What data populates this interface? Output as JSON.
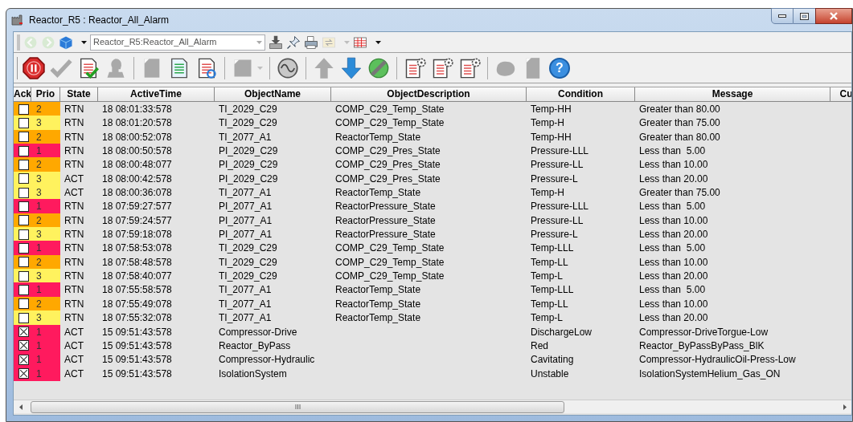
{
  "window": {
    "title": "Reactor_R5 : Reactor_All_Alarm"
  },
  "address_bar": {
    "value": "Reactor_R5:Reactor_All_Alarm",
    "tools": [
      {
        "kind": "back",
        "disabled": true
      },
      {
        "kind": "forward",
        "disabled": true
      },
      {
        "kind": "cube",
        "disabled": false
      },
      {
        "kind": "combo",
        "disabled": false
      },
      {
        "kind": "tray",
        "disabled": false
      },
      {
        "kind": "pin",
        "disabled": false
      },
      {
        "kind": "printer",
        "disabled": false
      },
      {
        "kind": "swap",
        "disabled": true
      },
      {
        "kind": "grid",
        "disabled": false
      }
    ]
  },
  "toolbar": [
    {
      "kind": "stop",
      "disabled": false
    },
    {
      "kind": "check",
      "disabled": true
    },
    {
      "kind": "checklist",
      "disabled": false
    },
    {
      "kind": "head",
      "disabled": true
    },
    {
      "kind": "separator"
    },
    {
      "kind": "page",
      "disabled": true
    },
    {
      "kind": "list",
      "disabled": false
    },
    {
      "kind": "page-refresh",
      "disabled": false
    },
    {
      "kind": "separator"
    },
    {
      "kind": "page-menu",
      "disabled": true
    },
    {
      "kind": "separator"
    },
    {
      "kind": "wave",
      "disabled": false
    },
    {
      "kind": "separator"
    },
    {
      "kind": "up",
      "disabled": true
    },
    {
      "kind": "down",
      "disabled": false
    },
    {
      "kind": "link",
      "disabled": false
    },
    {
      "kind": "separator"
    },
    {
      "kind": "page-gear",
      "disabled": false
    },
    {
      "kind": "page-gear",
      "disabled": false
    },
    {
      "kind": "page-gear",
      "disabled": false
    },
    {
      "kind": "separator"
    },
    {
      "kind": "blob",
      "disabled": true
    },
    {
      "kind": "door",
      "disabled": true
    },
    {
      "kind": "help",
      "disabled": false,
      "glyph": "?"
    }
  ],
  "table": {
    "columns": [
      "Ack",
      "Prio",
      "State",
      "ActiveTime",
      "ObjectName",
      "ObjectDescription",
      "Condition",
      "Message",
      "Cu"
    ],
    "rows": [
      {
        "acked": false,
        "color": "#ffa800",
        "prio": "2",
        "state": "RTN",
        "time": "18 08:01:33:578",
        "name": "TI_2029_C29",
        "description": "COMP_C29_Temp_State",
        "condition": "Temp-HH",
        "message": "Greater than 80.00"
      },
      {
        "acked": false,
        "color": "#fff25e",
        "prio": "3",
        "state": "RTN",
        "time": "18 08:01:20:578",
        "name": "TI_2029_C29",
        "description": "COMP_C29_Temp_State",
        "condition": "Temp-H",
        "message": "Greater than 75.00"
      },
      {
        "acked": false,
        "color": "#ffa800",
        "prio": "2",
        "state": "RTN",
        "time": "18 08:00:52:078",
        "name": "TI_2077_A1",
        "description": "ReactorTemp_State",
        "condition": "Temp-HH",
        "message": "Greater than 80.00"
      },
      {
        "acked": false,
        "color": "#ff1a5e",
        "prio": "1",
        "state": "RTN",
        "time": "18 08:00:50:578",
        "name": "PI_2029_C29",
        "description": "COMP_C29_Pres_State",
        "condition": "Pressure-LLL",
        "message": "Less than  5.00"
      },
      {
        "acked": false,
        "color": "#ffa800",
        "prio": "2",
        "state": "RTN",
        "time": "18 08:00:48:077",
        "name": "PI_2029_C29",
        "description": "COMP_C29_Pres_State",
        "condition": "Pressure-LL",
        "message": "Less than 10.00"
      },
      {
        "acked": false,
        "color": "#fff25e",
        "prio": "3",
        "state": "ACT",
        "time": "18 08:00:42:578",
        "name": "PI_2029_C29",
        "description": "COMP_C29_Pres_State",
        "condition": "Pressure-L",
        "message": "Less than 20.00"
      },
      {
        "acked": false,
        "color": "#fff25e",
        "prio": "3",
        "state": "ACT",
        "time": "18 08:00:36:078",
        "name": "TI_2077_A1",
        "description": "ReactorTemp_State",
        "condition": "Temp-H",
        "message": "Greater than 75.00"
      },
      {
        "acked": false,
        "color": "#ff1a5e",
        "prio": "1",
        "state": "RTN",
        "time": "18 07:59:27:577",
        "name": "PI_2077_A1",
        "description": "ReactorPressure_State",
        "condition": "Pressure-LLL",
        "message": "Less than  5.00"
      },
      {
        "acked": false,
        "color": "#ffa800",
        "prio": "2",
        "state": "RTN",
        "time": "18 07:59:24:577",
        "name": "PI_2077_A1",
        "description": "ReactorPressure_State",
        "condition": "Pressure-LL",
        "message": "Less than 10.00"
      },
      {
        "acked": false,
        "color": "#fff25e",
        "prio": "3",
        "state": "RTN",
        "time": "18 07:59:18:078",
        "name": "PI_2077_A1",
        "description": "ReactorPressure_State",
        "condition": "Pressure-L",
        "message": "Less than 20.00"
      },
      {
        "acked": false,
        "color": "#ff1a5e",
        "prio": "1",
        "state": "RTN",
        "time": "18 07:58:53:078",
        "name": "TI_2029_C29",
        "description": "COMP_C29_Temp_State",
        "condition": "Temp-LLL",
        "message": "Less than  5.00"
      },
      {
        "acked": false,
        "color": "#ffa800",
        "prio": "2",
        "state": "RTN",
        "time": "18 07:58:48:578",
        "name": "TI_2029_C29",
        "description": "COMP_C29_Temp_State",
        "condition": "Temp-LL",
        "message": "Less than 10.00"
      },
      {
        "acked": false,
        "color": "#fff25e",
        "prio": "3",
        "state": "RTN",
        "time": "18 07:58:40:077",
        "name": "TI_2029_C29",
        "description": "COMP_C29_Temp_State",
        "condition": "Temp-L",
        "message": "Less than 20.00"
      },
      {
        "acked": false,
        "color": "#ff1a5e",
        "prio": "1",
        "state": "RTN",
        "time": "18 07:55:58:578",
        "name": "TI_2077_A1",
        "description": "ReactorTemp_State",
        "condition": "Temp-LLL",
        "message": "Less than  5.00"
      },
      {
        "acked": false,
        "color": "#ffa800",
        "prio": "2",
        "state": "RTN",
        "time": "18 07:55:49:078",
        "name": "TI_2077_A1",
        "description": "ReactorTemp_State",
        "condition": "Temp-LL",
        "message": "Less than 10.00"
      },
      {
        "acked": false,
        "color": "#fff25e",
        "prio": "3",
        "state": "RTN",
        "time": "18 07:55:32:078",
        "name": "TI_2077_A1",
        "description": "ReactorTemp_State",
        "condition": "Temp-L",
        "message": "Less than 20.00"
      },
      {
        "acked": true,
        "color": "#ff1a5e",
        "prio": "1",
        "state": "ACT",
        "time": "15 09:51:43:578",
        "name": "Compressor-Drive",
        "condition": "DischargeLow",
        "message": "Compressor-DriveTorgue-Low"
      },
      {
        "acked": true,
        "color": "#ff1a5e",
        "prio": "1",
        "state": "ACT",
        "time": "15 09:51:43:578",
        "name": "Reactor_ByPass",
        "condition": "Red",
        "message": "Reactor_ByPassByPass_BlK"
      },
      {
        "acked": true,
        "color": "#ff1a5e",
        "prio": "1",
        "state": "ACT",
        "time": "15 09:51:43:578",
        "name": "Compressor-Hydraulic",
        "condition": "Cavitating",
        "message": "Compressor-HydraulicOil-Press-Low"
      },
      {
        "acked": true,
        "color": "#ff1a5e",
        "prio": "1",
        "state": "ACT",
        "time": "15 09:51:43:578",
        "name": "IsolationSystem",
        "condition": "Unstable",
        "message": "IsolationSystemHelium_Gas_ON"
      }
    ]
  }
}
